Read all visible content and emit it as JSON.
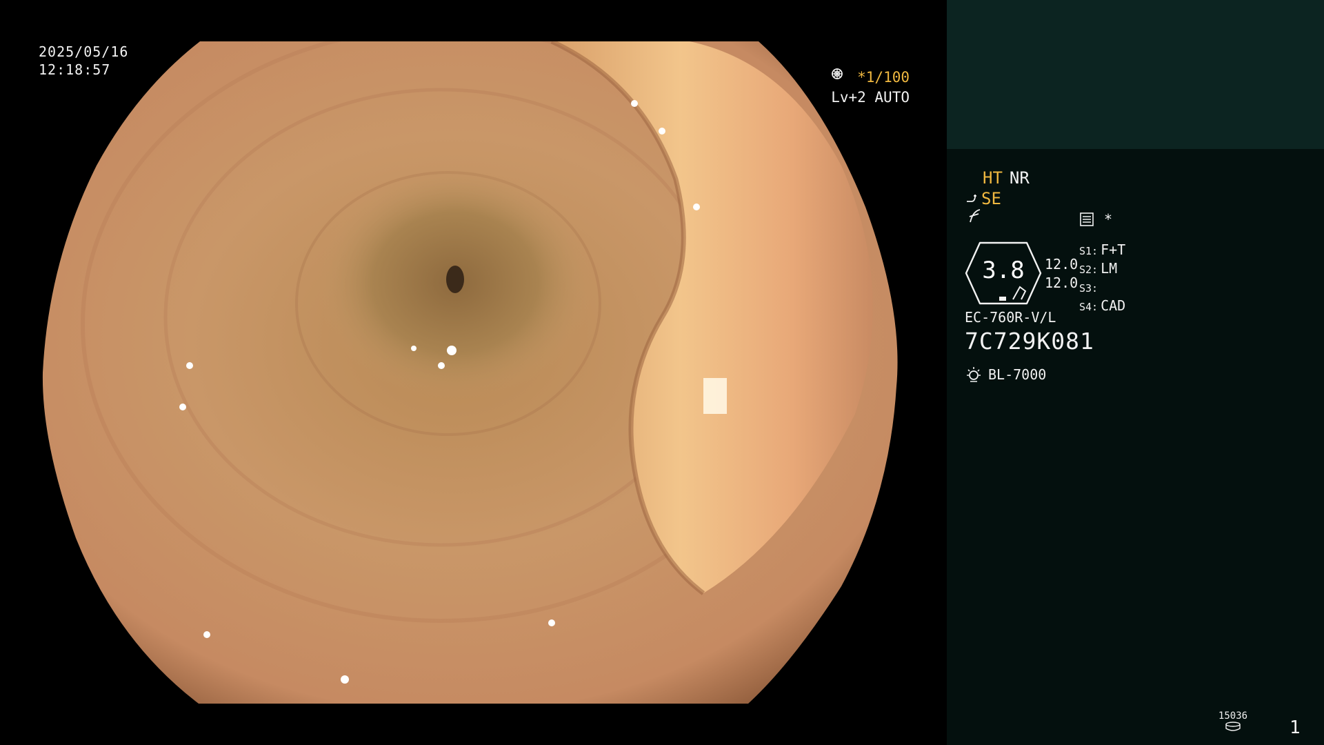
{
  "overlay": {
    "date": "2025/05/16",
    "time": "12:18:57",
    "shutter": "*1/100",
    "level": "Lv+2 AUTO"
  },
  "panel": {
    "mode_ht": "HT",
    "mode_nr": "NR",
    "mode_se": "SE",
    "record_symbol": "*",
    "magnification": "3.8",
    "mag_values": [
      "12.0",
      "12.0"
    ],
    "switches": [
      {
        "key": "S1:",
        "value": "F+T"
      },
      {
        "key": "S2:",
        "value": "LM"
      },
      {
        "key": "S3:",
        "value": ""
      },
      {
        "key": "S4:",
        "value": "CAD"
      }
    ],
    "scope_model": "EC-760R-V/L",
    "scope_serial": "7C729K081",
    "light_source": "BL-7000",
    "image_counter": "15036",
    "page_number": "1"
  },
  "colors": {
    "accent_yellow": "#f0b840",
    "panel_bg": "#04100e",
    "panel_top": "#0c2421"
  },
  "icons": [
    "shutter-icon",
    "auto-iris-icon",
    "scope-bend-icon",
    "freeze-icon",
    "record-list-icon",
    "light-source-icon",
    "storage-icon"
  ]
}
